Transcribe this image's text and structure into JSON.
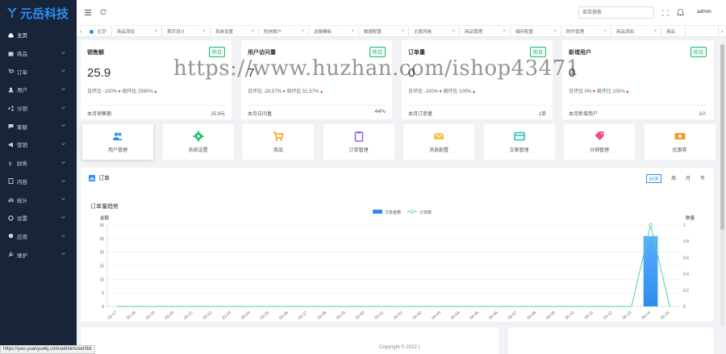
{
  "app": {
    "logo_text": "元岳科技",
    "brand_color": "#2d8cf0"
  },
  "sidebar": {
    "items": [
      {
        "label": "主页",
        "icon": "home-icon",
        "has_chevron": false
      },
      {
        "label": "商品",
        "icon": "goods-icon",
        "has_chevron": true
      },
      {
        "label": "订单",
        "icon": "order-icon",
        "has_chevron": true
      },
      {
        "label": "用户",
        "icon": "user-icon",
        "has_chevron": true
      },
      {
        "label": "分销",
        "icon": "share-icon",
        "has_chevron": true
      },
      {
        "label": "客服",
        "icon": "service-icon",
        "has_chevron": true
      },
      {
        "label": "营销",
        "icon": "marketing-icon",
        "has_chevron": true
      },
      {
        "label": "财务",
        "icon": "finance-icon",
        "has_chevron": true
      },
      {
        "label": "内容",
        "icon": "content-icon",
        "has_chevron": true
      },
      {
        "label": "统计",
        "icon": "stats-icon",
        "has_chevron": true
      },
      {
        "label": "设置",
        "icon": "settings-icon",
        "has_chevron": true
      },
      {
        "label": "应用",
        "icon": "apps-icon",
        "has_chevron": true
      },
      {
        "label": "维护",
        "icon": "maintain-icon",
        "has_chevron": true
      }
    ]
  },
  "header": {
    "search_placeholder": "菜单搜索",
    "user": "admin"
  },
  "tabs": [
    {
      "label": "主页",
      "active": true
    },
    {
      "label": "商品添加"
    },
    {
      "label": "首页设计"
    },
    {
      "label": "系统设置"
    },
    {
      "label": "短信账户"
    },
    {
      "label": "运输模板"
    },
    {
      "label": "数据配置"
    },
    {
      "label": "主题风格"
    },
    {
      "label": "商品管理"
    },
    {
      "label": "储存配置"
    },
    {
      "label": "附件管理"
    },
    {
      "label": "商品添加"
    },
    {
      "label": "商品"
    }
  ],
  "stats": [
    {
      "title": "销售额",
      "badge": "昨日",
      "value": "25.9",
      "day_label": "日环比 -100%",
      "week_label": "周环比 2590%",
      "foot_label": "本月销售额",
      "foot_value": "25.9元"
    },
    {
      "title": "用户访问量",
      "badge": "昨日",
      "value": "7",
      "day_label": "日环比 -28.57%",
      "week_label": "周环比 51.57%",
      "foot_label": "本月访问量",
      "foot_value": "44Pv"
    },
    {
      "title": "订单量",
      "badge": "昨日",
      "value": "0",
      "day_label": "日环比 -100%",
      "week_label": "周环比 100%",
      "foot_label": "本月订单量",
      "foot_value": "1单"
    },
    {
      "title": "新增用户",
      "badge": "昨日",
      "value": "0",
      "day_label": "日环比 0%",
      "week_label": "周环比 100%",
      "foot_label": "本月新增用户",
      "foot_value": "3人"
    }
  ],
  "quick_links": [
    {
      "label": "用户管理",
      "icon": "users-icon",
      "color": "#2d8cf0"
    },
    {
      "label": "系统设置",
      "icon": "gear-icon",
      "color": "#19be6b"
    },
    {
      "label": "商品",
      "icon": "cart-icon",
      "color": "#ff9900"
    },
    {
      "label": "订单管理",
      "icon": "clipboard-icon",
      "color": "#9b59f6"
    },
    {
      "label": "消息配置",
      "icon": "mail-icon",
      "color": "#f5c443"
    },
    {
      "label": "文章管理",
      "icon": "card-icon",
      "color": "#1cc3b0"
    },
    {
      "label": "分销管理",
      "icon": "tag-icon",
      "color": "#f04a8a"
    },
    {
      "label": "优惠券",
      "icon": "coupon-icon",
      "color": "#f59a23"
    }
  ],
  "order_section": {
    "title": "订单",
    "ranges": [
      "30天",
      "周",
      "月",
      "年"
    ],
    "active_range": "30天"
  },
  "chart_data": {
    "type": "bar",
    "title": "订单量趋势",
    "xlabel": "",
    "ylabel": "金额",
    "y2label": "数量",
    "ylim": [
      0,
      30
    ],
    "y2lim": [
      0,
      1
    ],
    "yticks": [
      0,
      5,
      10,
      15,
      20,
      25,
      30
    ],
    "y2ticks": [
      0,
      0.2,
      0.4,
      0.6,
      0.8,
      1
    ],
    "categories": [
      "03-17",
      "03-18",
      "03-19",
      "03-20",
      "03-21",
      "03-22",
      "03-23",
      "03-24",
      "03-25",
      "03-26",
      "03-27",
      "03-28",
      "03-29",
      "03-30",
      "03-31",
      "04-01",
      "04-02",
      "04-03",
      "04-04",
      "04-05",
      "04-06",
      "04-07",
      "04-08",
      "04-09",
      "04-10",
      "04-11",
      "04-12",
      "04-13",
      "04-14",
      "04-15"
    ],
    "series": [
      {
        "name": "订单金额",
        "type": "bar",
        "color": "#2d8cf0",
        "values": [
          0,
          0,
          0,
          0,
          0,
          0,
          0,
          0,
          0,
          0,
          0,
          0,
          0,
          0,
          0,
          0,
          0,
          0,
          0,
          0,
          0,
          0,
          0,
          0,
          0,
          0,
          0,
          0,
          25.9,
          0
        ]
      },
      {
        "name": "订单数",
        "type": "line",
        "color": "#4fd1a5",
        "values": [
          0,
          0,
          0,
          0,
          0,
          0,
          0,
          0,
          0,
          0,
          0,
          0,
          0,
          0,
          0,
          0,
          0,
          0,
          0,
          0,
          0,
          0,
          0,
          0,
          0,
          0,
          0,
          0,
          1,
          0
        ]
      }
    ],
    "legend": "top-center",
    "grid": true
  },
  "footer": {
    "copyright": "Copyright © 2022 |"
  },
  "status_bar_url": "https://yao.yuanyuekj.com/admin/user/list",
  "watermark": "https://www.huzhan.com/ishop43471"
}
